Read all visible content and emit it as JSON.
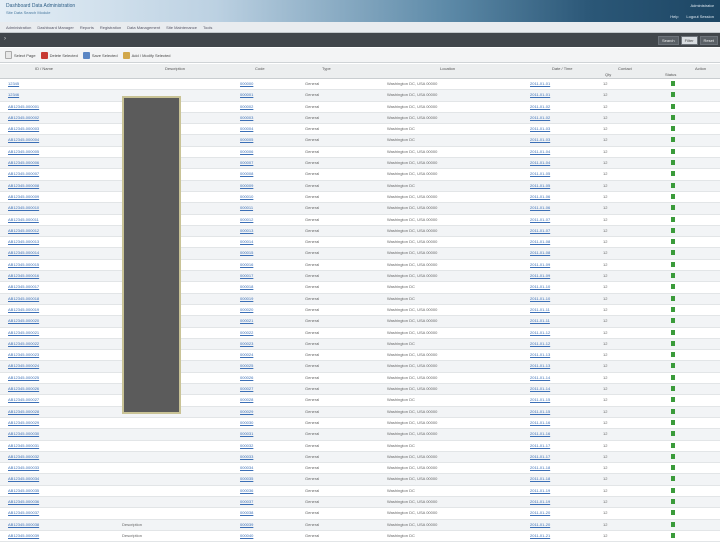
{
  "banner": {
    "title": "Dashboard Data Administration",
    "subtitle": "Site Data Search Module",
    "user": "Administrator",
    "right_links": [
      "Help",
      "Logout Session"
    ]
  },
  "menu": {
    "items": [
      "Administration",
      "Dashboard Manager",
      "Reports",
      "Registration",
      "Data Management",
      "Site Maintenance",
      "Tools"
    ]
  },
  "darkstrip": {
    "buttons": [
      "Search",
      "Filter",
      "Reset"
    ]
  },
  "toolbar": {
    "items": [
      {
        "label": "Select Page",
        "icon": "doc-icon"
      },
      {
        "label": "Delete Selected",
        "icon": "delete-icon"
      },
      {
        "label": "Save Selected",
        "icon": "save-icon"
      },
      {
        "label": "Add / Modify Selected",
        "icon": "edit-icon"
      }
    ]
  },
  "table": {
    "columns": [
      "ID / Name",
      "Description",
      "Code",
      "Type",
      "Location",
      "Date / Time",
      "Contact",
      "Qty",
      "Status",
      "Action"
    ],
    "rows": [
      {
        "id": "12345",
        "code": "000000",
        "type": "General",
        "loc": "Washington DC, USA 00000",
        "date": "2011-01-01",
        "qty": "12"
      },
      {
        "id": "12346",
        "code": "000001",
        "type": "General",
        "loc": "Washington DC, USA 00000",
        "date": "2011-01-01",
        "qty": "12"
      },
      {
        "id": "AB12345-000001",
        "code": "000002",
        "type": "General",
        "loc": "Washington DC, USA 00000",
        "date": "2011-01-02",
        "qty": "12"
      },
      {
        "id": "AB12345-000002",
        "code": "000003",
        "type": "General",
        "loc": "Washington DC, USA 00000",
        "date": "2011-01-02",
        "qty": "12"
      },
      {
        "id": "AB12345-000003",
        "code": "000004",
        "type": "General",
        "loc": "Washington DC",
        "date": "2011-01-03",
        "qty": "12"
      },
      {
        "id": "AB12345-000004",
        "code": "000005",
        "type": "General",
        "loc": "Washington DC",
        "date": "2011-01-03",
        "qty": "12"
      },
      {
        "id": "AB12345-000005",
        "code": "000006",
        "type": "General",
        "loc": "Washington DC, USA 00000",
        "date": "2011-01-04",
        "qty": "12"
      },
      {
        "id": "AB12345-000006",
        "code": "000007",
        "type": "General",
        "loc": "Washington DC, USA 00000",
        "date": "2011-01-04",
        "qty": "12"
      },
      {
        "id": "AB12345-000007",
        "code": "000008",
        "type": "General",
        "loc": "Washington DC, USA 00000",
        "date": "2011-01-05",
        "qty": "12"
      },
      {
        "id": "AB12345-000008",
        "code": "000009",
        "type": "General",
        "loc": "Washington DC",
        "date": "2011-01-05",
        "qty": "12"
      },
      {
        "id": "AB12345-000009",
        "code": "000010",
        "type": "General",
        "loc": "Washington DC, USA 00000",
        "date": "2011-01-06",
        "qty": "12"
      },
      {
        "id": "AB12345-000010",
        "code": "000011",
        "type": "General",
        "loc": "Washington DC, USA 00000",
        "date": "2011-01-06",
        "qty": "12"
      },
      {
        "id": "AB12345-000011",
        "code": "000012",
        "type": "General",
        "loc": "Washington DC, USA 00000",
        "date": "2011-01-07",
        "qty": "12"
      },
      {
        "id": "AB12345-000012",
        "code": "000013",
        "type": "General",
        "loc": "Washington DC, USA 00000",
        "date": "2011-01-07",
        "qty": "12"
      },
      {
        "id": "AB12345-000013",
        "code": "000014",
        "type": "General",
        "loc": "Washington DC, USA 00000",
        "date": "2011-01-08",
        "qty": "12"
      },
      {
        "id": "AB12345-000014",
        "code": "000015",
        "type": "General",
        "loc": "Washington DC, USA 00000",
        "date": "2011-01-08",
        "qty": "12"
      },
      {
        "id": "AB12345-000015",
        "code": "000016",
        "type": "General",
        "loc": "Washington DC, USA 00000",
        "date": "2011-01-09",
        "qty": "12"
      },
      {
        "id": "AB12345-000016",
        "code": "000017",
        "type": "General",
        "loc": "Washington DC, USA 00000",
        "date": "2011-01-09",
        "qty": "12"
      },
      {
        "id": "AB12345-000017",
        "code": "000018",
        "type": "General",
        "loc": "Washington DC",
        "date": "2011-01-10",
        "qty": "12"
      },
      {
        "id": "AB12345-000018",
        "code": "000019",
        "type": "General",
        "loc": "Washington DC",
        "date": "2011-01-10",
        "qty": "12"
      },
      {
        "id": "AB12345-000019",
        "code": "000020",
        "type": "General",
        "loc": "Washington DC, USA 00000",
        "date": "2011-01-11",
        "qty": "12"
      },
      {
        "id": "AB12345-000020",
        "code": "000021",
        "type": "General",
        "loc": "Washington DC, USA 00000",
        "date": "2011-01-11",
        "qty": "12"
      },
      {
        "id": "AB12345-000021",
        "code": "000022",
        "type": "General",
        "loc": "Washington DC, USA 00000",
        "date": "2011-01-12",
        "qty": "12"
      },
      {
        "id": "AB12345-000022",
        "code": "000023",
        "type": "General",
        "loc": "Washington DC",
        "date": "2011-01-12",
        "qty": "12"
      },
      {
        "id": "AB12345-000023",
        "code": "000024",
        "type": "General",
        "loc": "Washington DC, USA 00000",
        "date": "2011-01-13",
        "qty": "12"
      },
      {
        "id": "AB12345-000024",
        "code": "000025",
        "type": "General",
        "loc": "Washington DC, USA 00000",
        "date": "2011-01-13",
        "qty": "12"
      },
      {
        "id": "AB12345-000025",
        "code": "000026",
        "type": "General",
        "loc": "Washington DC, USA 00000",
        "date": "2011-01-14",
        "qty": "12"
      },
      {
        "id": "AB12345-000026",
        "code": "000027",
        "type": "General",
        "loc": "Washington DC, USA 00000",
        "date": "2011-01-14",
        "qty": "12"
      },
      {
        "id": "AB12345-000027",
        "code": "000028",
        "type": "General",
        "loc": "Washington DC",
        "date": "2011-01-15",
        "qty": "12"
      },
      {
        "id": "AB12345-000028",
        "code": "000029",
        "type": "General",
        "loc": "Washington DC, USA 00000",
        "date": "2011-01-15",
        "qty": "12"
      },
      {
        "id": "AB12345-000029",
        "code": "000030",
        "type": "General",
        "loc": "Washington DC, USA 00000",
        "date": "2011-01-16",
        "qty": "12"
      },
      {
        "id": "AB12345-000030",
        "code": "000031",
        "type": "General",
        "loc": "Washington DC, USA 00000",
        "date": "2011-01-16",
        "qty": "12"
      },
      {
        "id": "AB12345-000031",
        "code": "000032",
        "type": "General",
        "loc": "Washington DC",
        "date": "2011-01-17",
        "qty": "12"
      },
      {
        "id": "AB12345-000032",
        "code": "000033",
        "type": "General",
        "loc": "Washington DC, USA 00000",
        "date": "2011-01-17",
        "qty": "12"
      },
      {
        "id": "AB12345-000033",
        "code": "000034",
        "type": "General",
        "loc": "Washington DC, USA 00000",
        "date": "2011-01-18",
        "qty": "12"
      },
      {
        "id": "AB12345-000034",
        "code": "000035",
        "type": "General",
        "loc": "Washington DC, USA 00000",
        "date": "2011-01-18",
        "qty": "12"
      },
      {
        "id": "AB12345-000035",
        "code": "000036",
        "type": "General",
        "loc": "Washington DC",
        "date": "2011-01-19",
        "qty": "12"
      },
      {
        "id": "AB12345-000036",
        "code": "000037",
        "type": "General",
        "loc": "Washington DC, USA 00000",
        "date": "2011-01-19",
        "qty": "12"
      },
      {
        "id": "AB12345-000037",
        "code": "000038",
        "type": "General",
        "loc": "Washington DC, USA 00000",
        "date": "2011-01-20",
        "qty": "12"
      },
      {
        "id": "AB12345-000038",
        "desc": "Description",
        "code": "000039",
        "type": "General",
        "loc": "Washington DC, USA 00000",
        "date": "2011-01-20",
        "qty": "12"
      },
      {
        "id": "AB12345-000039",
        "desc": "Description",
        "code": "000040",
        "type": "General",
        "loc": "Washington DC",
        "date": "2011-01-21",
        "qty": "12"
      }
    ]
  }
}
